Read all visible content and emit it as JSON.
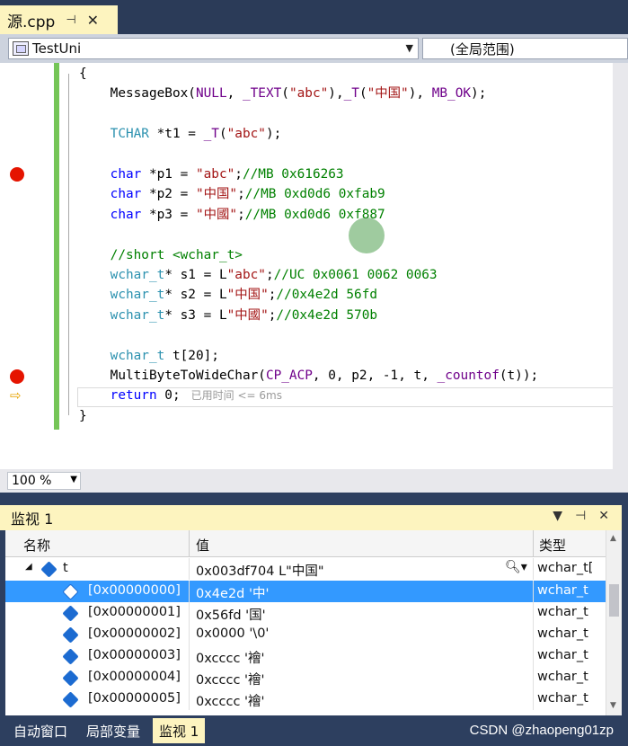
{
  "tab": {
    "title": "源.cpp",
    "pin": "⊣",
    "close": "✕"
  },
  "nav": {
    "scope": "TestUni",
    "global": "(全局范围)"
  },
  "code_lines": [
    "{",
    "    MessageBox(NULL, _TEXT(\"abc\"),_T(\"中国\"), MB_OK);",
    "",
    "    TCHAR *t1 = _T(\"abc\");",
    "",
    "    char *p1 = \"abc\";//MB 0x616263",
    "    char *p2 = \"中国\";//MB 0xd0d6 0xfab9",
    "    char *p3 = \"中國\";//MB 0xd0d6 0xf887",
    "",
    "    //short <wchar_t>",
    "    wchar_t* s1 = L\"abc\";//UC 0x0061 0062 0063",
    "    wchar_t* s2 = L\"中国\";//0x4e2d 56fd",
    "    wchar_t* s3 = L\"中國\";//0x4e2d 570b",
    "",
    "    wchar_t t[20];",
    "    MultiByteToWideChar(CP_ACP, 0, p2, -1, t, _countof(t));",
    "    return 0;",
    "}"
  ],
  "perf_tip": "已用时间 <= 6ms",
  "zoom": "100 %",
  "watch": {
    "title": "监视 1",
    "col_name": "名称",
    "col_value": "值",
    "col_type": "类型",
    "root": {
      "name": "t",
      "value": "0x003df704 L\"中国\"",
      "type": "wchar_t["
    },
    "rows": [
      {
        "name": "[0x00000000]",
        "value": "0x4e2d '中'",
        "type": "wchar_t"
      },
      {
        "name": "[0x00000001]",
        "value": "0x56fd '国'",
        "type": "wchar_t"
      },
      {
        "name": "[0x00000002]",
        "value": "0x0000 '\\0'",
        "type": "wchar_t"
      },
      {
        "name": "[0x00000003]",
        "value": "0xcccc '襘'",
        "type": "wchar_t"
      },
      {
        "name": "[0x00000004]",
        "value": "0xcccc '襘'",
        "type": "wchar_t"
      },
      {
        "name": "[0x00000005]",
        "value": "0xcccc '襘'",
        "type": "wchar_t"
      }
    ]
  },
  "bottom_tabs": [
    "自动窗口",
    "局部变量",
    "监视 1"
  ],
  "watermark": "CSDN @zhaopeng01zp"
}
